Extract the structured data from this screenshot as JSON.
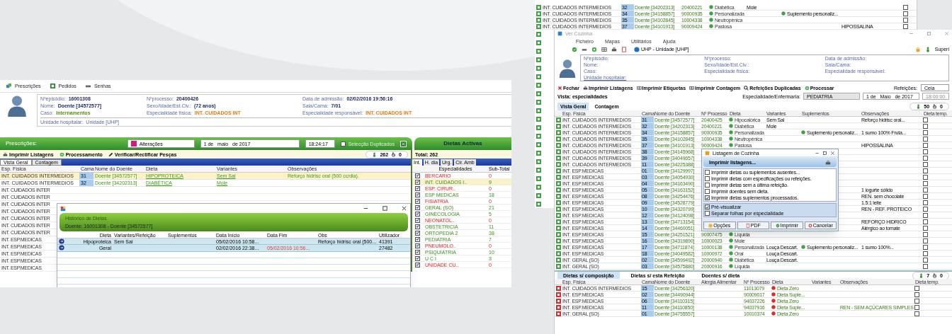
{
  "left_app": {
    "toolbar": [
      {
        "label": "Prescrições",
        "kind": "pills"
      },
      {
        "label": "Pedidos",
        "kind": "form"
      },
      {
        "label": "Senhas",
        "kind": "ticket"
      }
    ],
    "patient": [
      {
        "label": "Nºepisódio:",
        "value": "16001308",
        "kind": "id"
      },
      {
        "label": "Nºprocesso:",
        "value": "20400426",
        "kind": "id"
      },
      {
        "label": "Data de admissão:",
        "value": "02/02/2016 19:56:16",
        "kind": "id"
      },
      {
        "label": "Nome:",
        "value": "Doente [34572577]",
        "kind": "id"
      },
      {
        "label": "Sexo/Idade/Est.Civ.:",
        "value": "(72 anos)",
        "kind": "id"
      },
      {
        "label": "Sala/Cama:",
        "value": "7/01",
        "kind": "id"
      },
      {
        "label": "Caso:",
        "value": "Internamentos",
        "kind": "case"
      },
      {
        "label": "Especialidade física:",
        "value": "INT. CUIDADOS INT",
        "kind": "specialty"
      },
      {
        "label": "Especialidade responsável:",
        "value": "INT. CUIDADOS INT",
        "kind": "specialty"
      }
    ],
    "unit": {
      "label": "Unidade hospitalar:",
      "value": "Unidade [UHP]"
    },
    "header": {
      "title": "Prescrições:",
      "filter": {
        "label": "Alterações",
        "color": "#e0157f"
      },
      "date": "1 de   maio   de 2017",
      "time": "18:24:17",
      "duplicates": {
        "label": "Selecção Duplicados",
        "checked": false
      }
    },
    "actions": [
      {
        "label": "Imprimir Listagens",
        "kind": "print"
      },
      {
        "label": "Processamento",
        "kind": "gear"
      },
      {
        "label": "Verificar/Rectificar Pesças",
        "kind": "pencil"
      }
    ],
    "counts": [
      "262",
      "0"
    ],
    "tabs": [
      {
        "label": "Vista Geral",
        "selected": true
      },
      {
        "label": "Contagem",
        "selected": false
      }
    ],
    "columns": [
      "Esp. Física",
      "Cama",
      "Nome do Doente",
      "Dieta",
      "Variantes",
      "Observações"
    ],
    "rows": [
      {
        "esp": "INT. CUIDADOS INTERMEDIOS",
        "cama": "31",
        "doente": "Doente [34572577]",
        "dieta": "HIPOPROTEICA",
        "variantes": "Sem Sal",
        "obs": "Reforço hidrisc oral (500 cc/dia).",
        "selected": true
      },
      {
        "esp": "INT. CUIDADOS INTERMEDIOS",
        "cama": "32",
        "doente": "Doente [34202313]",
        "dieta": "DIABÉTICA",
        "variantes": "Mole",
        "obs": "",
        "selected": false
      }
    ],
    "covered_rows": [
      "INT. CUIDADOS INTER",
      "INT. CUIDADOS INTER",
      "INT. CUIDADOS INTER",
      "INT. CUIDADOS INTER",
      "INT. CUIDADOS INTER",
      "INT. CUIDADOS INTER",
      "INT. CUIDADOS INTER",
      "INT. ESP.MEDICAS",
      "INT. ESP.MEDICAS",
      "INT. ESP.MEDICAS",
      "INT. ESP.MEDICAS",
      "INT. ESP.MEDICAS"
    ],
    "active": {
      "title": "Dietas Activas",
      "total": "Total: 262",
      "tabs": [
        {
          "label": "Int.",
          "selected": true
        },
        {
          "label": "H. dia",
          "selected": false
        },
        {
          "label": "Urg.",
          "selected": false
        },
        {
          "label": "Cir. Amb",
          "selected": false
        }
      ],
      "columns": [
        "Especialidades",
        "Sub-Total"
      ],
      "items": [
        {
          "name": "BERCARIO",
          "total": "0",
          "checked": true,
          "kind": "empty",
          "selected": false
        },
        {
          "name": "INT. CUIDADOS I..",
          "total": "9",
          "checked": true,
          "kind": "filled",
          "selected": true
        },
        {
          "name": "ESP. CIRUR..",
          "total": "0",
          "checked": true,
          "kind": "empty",
          "selected": false
        },
        {
          "name": "ESP MEDICAS",
          "total": "18",
          "checked": true,
          "kind": "filled",
          "selected": false
        },
        {
          "name": "FISIATRIA",
          "total": "0",
          "checked": true,
          "kind": "empty",
          "selected": false
        },
        {
          "name": "GERAL (SO)",
          "total": "21",
          "checked": true,
          "kind": "filled",
          "selected": false
        },
        {
          "name": "GINECOLOGIA",
          "total": "5",
          "checked": true,
          "kind": "filled",
          "selected": false
        },
        {
          "name": "NEONATOL..",
          "total": "0",
          "checked": true,
          "kind": "empty",
          "selected": false
        },
        {
          "name": "OBSTETRICIA",
          "total": "11",
          "checked": true,
          "kind": "filled",
          "selected": false
        },
        {
          "name": "ORTOPEDIA 2",
          "total": "38",
          "checked": true,
          "kind": "filled",
          "selected": false
        },
        {
          "name": "PEDIATRIA",
          "total": "7",
          "checked": true,
          "kind": "filled",
          "selected": false
        },
        {
          "name": "PNEUMOLO..",
          "total": "0",
          "checked": true,
          "kind": "empty",
          "selected": false
        },
        {
          "name": "PSIQUIATRIA",
          "total": "10",
          "checked": true,
          "kind": "filled",
          "selected": false
        },
        {
          "name": "U C I",
          "total": "3",
          "checked": true,
          "kind": "filled",
          "selected": false
        },
        {
          "name": "UNIDADE CU..",
          "total": "0",
          "checked": true,
          "kind": "empty",
          "selected": false
        }
      ]
    },
    "dialog": {
      "title": "Histórico de Dietas",
      "subtitle": "Doente: 16001308 - Doente [34572577]",
      "columns": [
        "Dieta",
        "Variantes/Refeição",
        "Suplementos",
        "Data Início",
        "Data Fim",
        "Obs",
        "Utilizador"
      ],
      "rows": [
        {
          "dieta": "Hipoproteica",
          "variantes": "Sem Sal",
          "inicio": "05/02/2016 10:58...",
          "fim": "",
          "obs": "Reforço hidrisc oral (500...",
          "user": "41391"
        },
        {
          "dieta": "Geral",
          "variantes": "",
          "inicio": "02/02/2016 22:38...",
          "fim": "05/02/2016 10:56...",
          "obs": "",
          "user": "27482"
        }
      ]
    }
  },
  "right_app": {
    "background_rows": [
      {
        "esp": "INT. CUIDADOS INTERMEDIOS",
        "cama": "32",
        "doente": "Doente [34202313]",
        "processo": "20400221",
        "dieta": "Diabética",
        "variantes": "Mole",
        "temporaria": false
      },
      {
        "esp": "INT. CUIDADOS INTERMEDIOS",
        "cama": "34",
        "doente": "Doente [34158857]",
        "processo": "90000935",
        "dieta": "Personalizada",
        "suplementos": "Suplemento personaliz...",
        "temporaria": false
      },
      {
        "esp": "INT. CUIDADOS INTERMEDIOS",
        "cama": "35",
        "doente": "Doente [34102845]",
        "processo": "10004338",
        "dieta": "Neutropénica",
        "temporaria": false
      },
      {
        "esp": "INT. CUIDADOS INTERMEDIOS",
        "cama": "37",
        "doente": "Doente [34101913]",
        "processo": "90009424",
        "dieta": "Pastosa",
        "obs": "HIPOSSALINA",
        "temporaria": false
      }
    ],
    "window_title": "Ver Cozinha",
    "menu": [
      "Ficheiro",
      "Mapas",
      "Utilitários",
      "Ajuda"
    ],
    "unit_selector": "UHP - Unidade [UHP]",
    "user": "Superi",
    "patient_labels": [
      "Nºepisódio:",
      "Nºprocesso:",
      "Data de admissão:",
      "Nome:",
      "Sexo/Idade/Est.Civ.:",
      "Sala/Cama:",
      "Caso:",
      "Especialidade física:",
      "Especialidade responsável:"
    ],
    "unit_label": "Unidade hospitalar:",
    "actions": [
      {
        "label": "Fechar",
        "kind": "close"
      },
      {
        "label": "Imprimir Listagens",
        "kind": "print"
      },
      {
        "label": "Imprimir Etiquetas",
        "kind": "grid"
      },
      {
        "label": "Imprimir Contagem",
        "kind": "grid"
      },
      {
        "label": "Refeições Duplicadas",
        "kind": "search"
      },
      {
        "label": "Processar",
        "kind": "gear"
      }
    ],
    "refeicoes_label": "Refeições:",
    "refeicao": "Ceia",
    "vista": "Vista: especialidades",
    "esp_label": "Especialidade/Enfermaria:",
    "esp_value": "PEDIATRIA",
    "date": "1 de   Maio   de 2017",
    "time": "18:00:00",
    "tabs": [
      {
        "label": "Vista Geral",
        "selected": true
      },
      {
        "label": "Contagem",
        "selected": false
      }
    ],
    "counts": [
      "50",
      "0"
    ],
    "columns": [
      "Esp. Física",
      "Cama",
      "Nome do Doente",
      "Nº Processo",
      "Dieta",
      "Variantes",
      "Suplementos",
      "Observações",
      "Dieta temp."
    ],
    "rows": [
      {
        "esp": "INT. CUIDADOS INTERMEDIOS",
        "cama": "31",
        "doente": "Doente [34572577]",
        "processo": "20400425",
        "dieta": "Hipocalórica",
        "variantes": "Sem Sal",
        "obs": "Reforço hidrisc oral...",
        "temporaria": false
      },
      {
        "esp": "INT. CUIDADOS INTERMEDIOS",
        "cama": "32",
        "doente": "Doente [34202313]",
        "processo": "20400221",
        "dieta": "Diabética",
        "variantes": "Mole",
        "temporaria": false
      },
      {
        "esp": "INT. CUIDADOS INTERMEDIOS",
        "cama": "34",
        "doente": "Doente [34158857]",
        "processo": "90000935",
        "dieta": "Personalizada",
        "suplementos": "Suplemento personaliz...",
        "obs": "1 sumo 100% Fruta...",
        "temporaria": false
      },
      {
        "esp": "INT. CUIDADOS INTERMEDIOS",
        "cama": "35",
        "doente": "Doente [34102845]",
        "processo": "10004338",
        "dieta": "Neutropénica",
        "temporaria": false
      },
      {
        "esp": "INT. CUIDADOS INTERMEDIOS",
        "cama": "37",
        "doente": "Doente [34101913]",
        "processo": "90009424",
        "dieta": "Pastosa",
        "obs": "HIPOSSALINA",
        "temporaria": false
      },
      {
        "esp": "INT. CUIDADOS INTERMEDIOS",
        "cama": "38",
        "doente": "Doente [34145968]",
        "temporaria": false
      },
      {
        "esp": "INT. CUIDADOS INTERMEDIOS",
        "cama": "39",
        "doente": "Doente [34049657]",
        "temporaria": false
      },
      {
        "esp": "INT. CUIDADOS INTERMEDIOS",
        "cama": "11",
        "doente": "Doente [34225388]",
        "temporaria": false
      },
      {
        "esp": "INT. ESP.MEDICAS",
        "cama": "01",
        "doente": "Doente [34129997]",
        "temporaria": false
      },
      {
        "esp": "INT. ESP.MEDICAS",
        "cama": "03",
        "doente": "Doente [34054930]",
        "temporaria": false
      },
      {
        "esp": "INT. ESP.MEDICAS",
        "cama": "04",
        "doente": "Doente [34163490]",
        "temporaria": false
      },
      {
        "esp": "INT. ESP.MEDICAS",
        "cama": "05",
        "doente": "Doente [34163152]",
        "obs": "1 iogurte sólido",
        "temporaria": false
      },
      {
        "esp": "INT. ESP.MEDICAS",
        "cama": "08",
        "doente": "Doente [34254476]",
        "obs": "REN. sem chocolate",
        "temporaria": false
      },
      {
        "esp": "INT. ESP.MEDICAS",
        "cama": "09",
        "doente": "Doente [34528779]",
        "obs": "1.5:1 leite",
        "temporaria": false
      },
      {
        "esp": "INT. ESP.MEDICAS",
        "cama": "10",
        "doente": "Doente [34320799]",
        "obs": "REN - REF. PROTEICO",
        "temporaria": false
      },
      {
        "esp": "INT. ESP.MEDICAS",
        "cama": "12",
        "doente": "Doente [34124098]",
        "temporaria": false
      },
      {
        "esp": "INT. ESP.MEDICAS",
        "cama": "13",
        "doente": "Doente [34713154]",
        "obs": "REFORÇO HIDRICO",
        "temporaria": false
      },
      {
        "esp": "INT. ESP.MEDICAS",
        "cama": "14",
        "doente": "Doente [34460051]",
        "obs": "Alérgico ao tomate",
        "temporaria": false
      },
      {
        "esp": "INT. ESP.MEDICAS",
        "cama": "15",
        "doente": "Doente [34251521]",
        "processo": "90007475",
        "dieta": "Líquida",
        "temporaria": false
      },
      {
        "esp": "INT. ESP.MEDICAS",
        "cama": "16",
        "doente": "Doente [34319890]",
        "processo": "10000023",
        "dieta": "Mole",
        "temporaria": false
      },
      {
        "esp": "INT. ESP.MEDICAS",
        "cama": "17",
        "doente": "Doente [34711874]",
        "processo": "10000138",
        "dieta": "Personalizada",
        "variantes": "Louça Descart.",
        "suplementos": "Suplemento personaliz...",
        "obs": "1 sumo 100%...",
        "temporaria": false
      },
      {
        "esp": "INT. ESP.MEDICAS",
        "cama": "18",
        "doente": "Doente [34049582]",
        "processo": "10000972",
        "dieta": "Oral",
        "variantes": "Louça Descart.",
        "temporaria": false
      },
      {
        "esp": "INT. GERAL (SO)",
        "cama": "02",
        "doente": "Doente [34599492]",
        "processo": "20000940",
        "dieta": "Diabética",
        "variantes": "Louça Descart.",
        "temporaria": false
      },
      {
        "esp": "INT. GERAL (SO)",
        "cama": "03",
        "doente": "Doente [34575880]",
        "processo": "20000916",
        "dieta": "Líquida",
        "temporaria": false
      }
    ],
    "dialog": {
      "title": "Listagem de Cozinha",
      "header": "Imprimir listagens...",
      "options": [
        {
          "label": "Imprimir dietas ou suplementos ausentes...",
          "checked": false
        },
        {
          "label": "Imprimir dietas com especificações ou refeições.",
          "checked": false
        },
        {
          "label": "Imprimir dietas sem a última refeição.",
          "checked": false
        },
        {
          "label": "Imprimir doentes sem dieta.",
          "checked": false
        },
        {
          "label": "Imprimir dietas suplementos processados.",
          "checked": true
        }
      ],
      "options2": [
        {
          "label": "Pré-visualizar",
          "checked": true
        },
        {
          "label": "Separar folhas por especialidade",
          "checked": false
        }
      ],
      "buttons": [
        {
          "label": "Opções",
          "kind": "options"
        },
        {
          "label": "PDF",
          "kind": "pdf"
        },
        {
          "label": "Imprimir",
          "kind": "ok"
        },
        {
          "label": "Cancelar",
          "kind": "cancel"
        }
      ]
    },
    "bottom_tabs": [
      {
        "label": "Dietas s/ composição",
        "selected": true
      },
      {
        "label": "Dietas s/ esta Refeição",
        "selected": false
      },
      {
        "label": "Doentes s/ dieta",
        "selected": false
      }
    ],
    "bottom_counts": [
      "7",
      "0"
    ],
    "bottom_columns": [
      "Esp. Física",
      "Cama",
      "Nome do Doente",
      "Alergia Alimentar",
      "Nº Processo",
      "Dieta",
      "Variantes",
      "Observações",
      "Dieta temp."
    ],
    "bottom_rows": [
      {
        "esp": "INT. CUIDADOS INTERMEDIOS",
        "cama": "15",
        "doente": "Doente [34256320]",
        "processo": "11013079",
        "dieta": "Dieta Zero",
        "temporaria": false
      },
      {
        "esp": "INT. ESP.MEDICAS",
        "cama": "02",
        "doente": "Doente [34490944]",
        "processo": "90009017",
        "dieta": "Dieta Suple...",
        "temporaria": false
      },
      {
        "esp": "INT. ESP.MEDICAS",
        "cama": "06",
        "doente": "Doente [34110315]",
        "processo": "94037226",
        "dieta": "Dieta Zero",
        "temporaria": false
      },
      {
        "esp": "INT. ESP.MEDICAS",
        "cama": "11",
        "doente": "Doente [34110850]",
        "processo": "94037916",
        "dieta": "Dieta Suple...",
        "obs": "REN - SEM AÇÚCARES SIMPLES",
        "temporaria": false
      },
      {
        "esp": "INT. GERAL (SO)",
        "cama": "01",
        "doente": "Doente [34755557]",
        "processo": "10010374",
        "dieta": "Dieta Zero",
        "temporaria": false
      }
    ]
  }
}
